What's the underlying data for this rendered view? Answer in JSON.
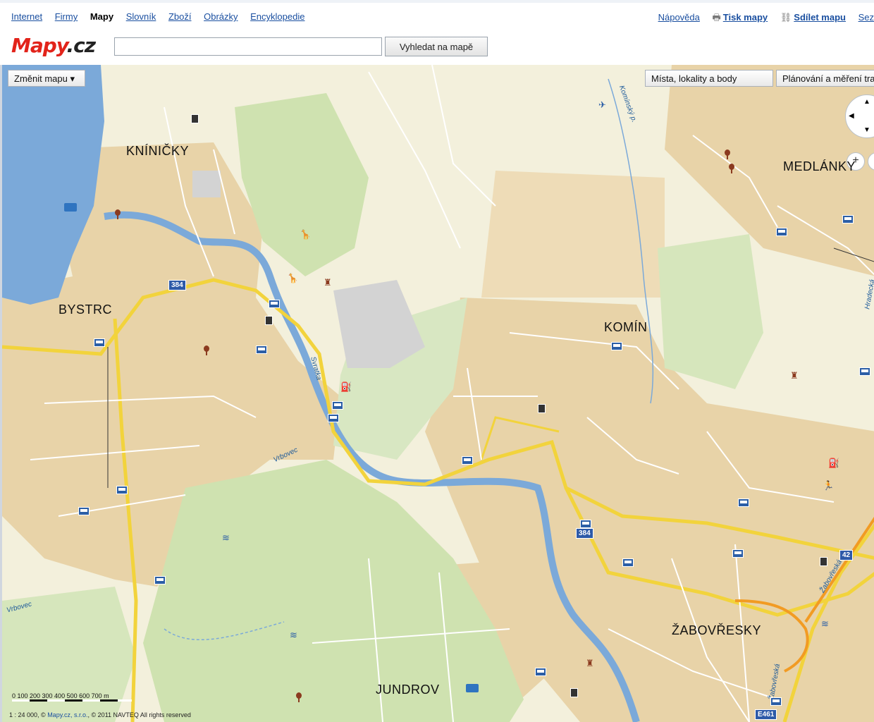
{
  "nav": {
    "internet": "Internet",
    "firmy": "Firmy",
    "mapy": "Mapy",
    "slovnik": "Slovník",
    "zbozi": "Zboží",
    "obrazky": "Obrázky",
    "encyklopedie": "Encyklopedie",
    "napoveda": "Nápověda",
    "tisk": "Tisk mapy",
    "sdilet": "Sdílet mapu",
    "sez": "Sez"
  },
  "logo": {
    "text": "Mapy",
    "suffix": ".cz"
  },
  "search": {
    "value": "",
    "button": "Vyhledat na mapě"
  },
  "map_controls": {
    "change_map": "Změnit mapu ▾",
    "places": "Místa, lokality a body",
    "routing": "Plánování a měření tras",
    "zoom_in": "+",
    "zoom_out": "−"
  },
  "places": {
    "kninicky": "KNÍNIČKY",
    "bystrc": "BYSTRC",
    "komin": "KOMÍN",
    "medlanky": "MEDLÁNKY",
    "zabovresky": "ŽABOVŘESKY",
    "jundrov": "JUNDROV"
  },
  "labels": {
    "svratka": "Svratka",
    "vrbovec1": "Vrbovec",
    "vrbovec2": "Vrbovec",
    "kominsky": "Komínský p.",
    "zabovreska1": "Žabovřeská",
    "zabovreska2": "Žabovřeská",
    "hradecka": "Hradecká"
  },
  "shields": {
    "r384a": "384",
    "r384b": "384",
    "r42": "42",
    "e461": "E461"
  },
  "scale": {
    "ticks": "0   100  200  300  400  500  600  700 m"
  },
  "copyright": {
    "prefix": "1 : 24 000, ©",
    "link": "Mapy.cz, s.r.o.",
    "suffix": ", © 2011 NAVTEQ All rights reserved"
  },
  "colors": {
    "urban": "#e8d3a8",
    "forest": "#cfe2b0",
    "water": "#7ba9d9",
    "road_main": "#f2d33c",
    "background": "#f3f0dc"
  }
}
